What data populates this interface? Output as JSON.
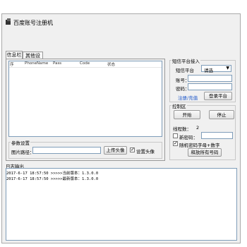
{
  "window": {
    "title": "百度账号注册机"
  },
  "tabs": [
    {
      "label": "信息栏"
    },
    {
      "label": "其他设置"
    }
  ],
  "list": {
    "columns": [
      "序",
      "PhoneName",
      "Pass",
      "Code",
      "状态"
    ]
  },
  "params": {
    "group_label": "参数设置",
    "image_path_label": "图片路径：",
    "image_path_value": "",
    "upload_button": "上传头像",
    "set_avatar_label": "设置头像",
    "set_avatar_checked": true
  },
  "sms": {
    "group_label": "短信平台接入",
    "platform_label": "短信平台",
    "platform_selected": "请选",
    "account_label": "账号：",
    "password_label": "密码：",
    "register_link": "注册/充值",
    "login_button": "登录平台"
  },
  "control": {
    "group_label": "控制区",
    "start_button": "开始",
    "stop_button": "停止",
    "threads_label": "线程数：",
    "threads_value": "2",
    "new_password_label": "新密码：",
    "random_password_label": "随机密码字母+数字",
    "random_password_checked": true,
    "release_button": "释放所有号码"
  },
  "log": {
    "label": "日志输出",
    "lines": [
      "2017-6-17 18:57:50 >>>>>当前版本：1.3.0.0",
      "2017-6-17 18:57:50 >>>>>最新版本：1.3.0.0"
    ]
  }
}
